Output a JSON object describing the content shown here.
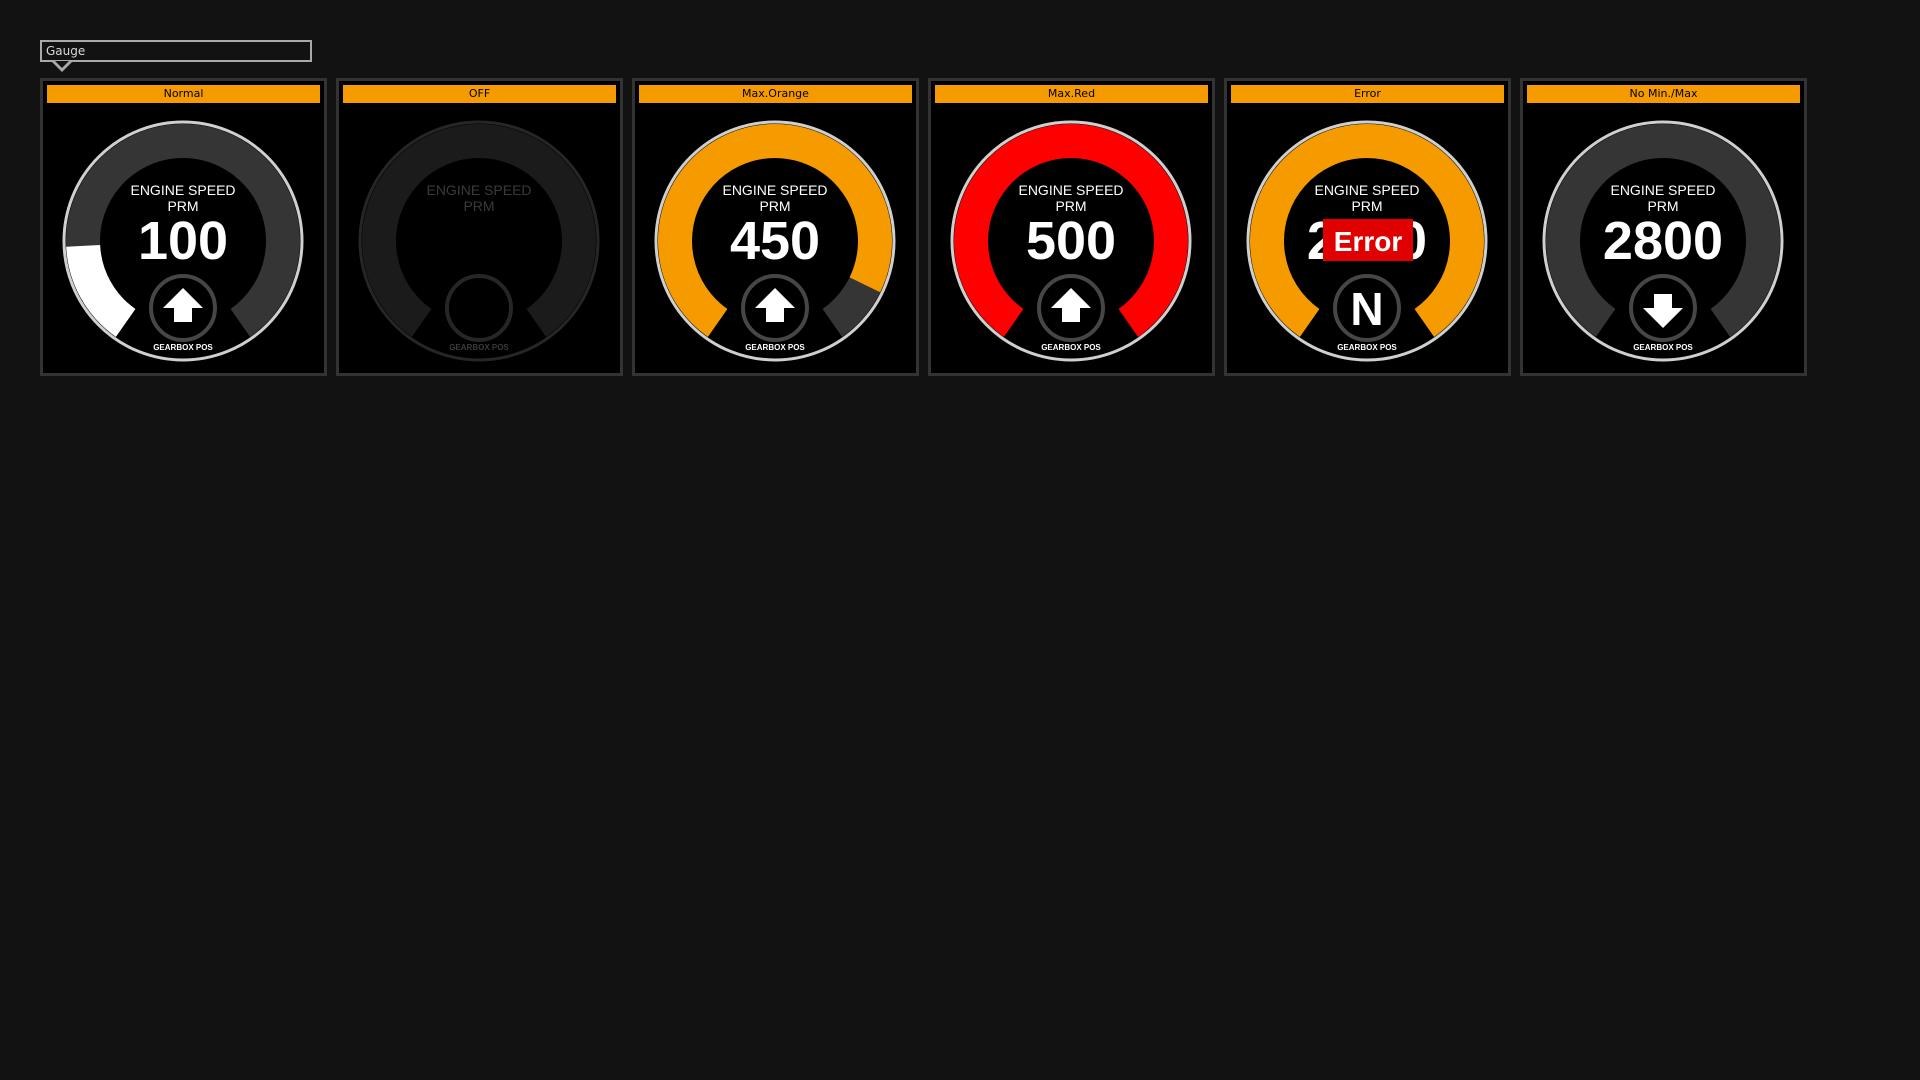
{
  "group_label": "Gauge",
  "colors": {
    "background": "#121212",
    "header": "#f59b00",
    "track": "#353535",
    "white": "#ffffff",
    "orange": "#f59b00",
    "red": "#ff0000",
    "error_bg": "#e00000"
  },
  "gauges": [
    {
      "state": "Normal",
      "title": "ENGINE SPEED",
      "unit": "PRM",
      "value": "100",
      "gear": "up-arrow",
      "gear_label": "GEARBOX POS",
      "level": 0.18,
      "fill": "#ffffff"
    },
    {
      "state": "OFF",
      "title": "ENGINE SPEED",
      "unit": "PRM",
      "value": "",
      "gear": "none",
      "gear_label": "GEARBOX POS",
      "level": 0,
      "fill": "#222222"
    },
    {
      "state": "Max.Orange",
      "title": "ENGINE SPEED",
      "unit": "PRM",
      "value": "450",
      "gear": "up-arrow",
      "gear_label": "GEARBOX POS",
      "level": 0.9,
      "fill": "#f59b00"
    },
    {
      "state": "Max.Red",
      "title": "ENGINE SPEED",
      "unit": "PRM",
      "value": "500",
      "gear": "up-arrow",
      "gear_label": "GEARBOX POS",
      "level": 1.0,
      "fill": "#ff0000"
    },
    {
      "state": "Error",
      "title": "ENGINE SPEED",
      "unit": "PRM",
      "value": "2800",
      "error_text": "Error",
      "gear": "N",
      "gear_label": "GEARBOX POS",
      "level": 1.0,
      "fill": "#f59b00"
    },
    {
      "state": "No Min./Max",
      "title": "ENGINE SPEED",
      "unit": "PRM",
      "value": "2800",
      "gear": "down-arrow",
      "gear_label": "GEARBOX POS",
      "level": 0,
      "fill": "#353535"
    }
  ]
}
